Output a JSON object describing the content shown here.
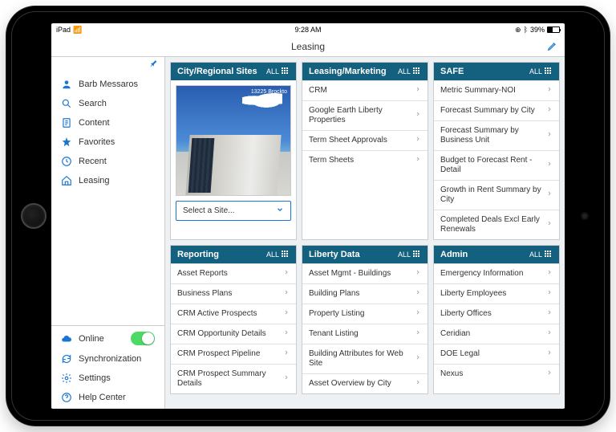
{
  "status": {
    "carrier": "iPad",
    "time": "9:28 AM",
    "batteryPct": "39%"
  },
  "page": {
    "title": "Leasing"
  },
  "sidebar": {
    "top": [
      {
        "label": "Barb Messaros",
        "icon": "user"
      },
      {
        "label": "Search",
        "icon": "search"
      },
      {
        "label": "Content",
        "icon": "content"
      },
      {
        "label": "Favorites",
        "icon": "star"
      },
      {
        "label": "Recent",
        "icon": "clock"
      },
      {
        "label": "Leasing",
        "icon": "home"
      }
    ],
    "bottom": [
      {
        "label": "Online",
        "icon": "cloud",
        "toggle": true
      },
      {
        "label": "Synchronization",
        "icon": "sync"
      },
      {
        "label": "Settings",
        "icon": "gear"
      },
      {
        "label": "Help Center",
        "icon": "help"
      }
    ]
  },
  "tiles": [
    {
      "title": "City/Regional Sites",
      "all": "ALL",
      "type": "image",
      "imageLabel": "13225 Brockto",
      "selectPlaceholder": "Select a Site..."
    },
    {
      "title": "Leasing/Marketing",
      "all": "ALL",
      "items": [
        "CRM",
        "Google Earth Liberty Properties",
        "Term Sheet Approvals",
        "Term Sheets"
      ]
    },
    {
      "title": "SAFE",
      "all": "ALL",
      "items": [
        "Metric Summary-NOI",
        "Forecast Summary by City",
        "Forecast Summary by Business Unit",
        "Budget to Forecast Rent - Detail",
        "Growth in Rent Summary by City",
        "Completed Deals Excl Early Renewals"
      ]
    },
    {
      "title": "Reporting",
      "all": "ALL",
      "items": [
        "Asset Reports",
        "Business Plans",
        "CRM Active Prospects",
        "CRM Opportunity Details",
        "CRM Prospect Pipeline",
        "CRM Prospect Summary Details"
      ]
    },
    {
      "title": "Liberty Data",
      "all": "ALL",
      "items": [
        "Asset Mgmt - Buildings",
        "Building Plans",
        "Property Listing",
        "Tenant Listing",
        "Building Attributes for Web Site",
        "Asset Overview by City"
      ]
    },
    {
      "title": "Admin",
      "all": "ALL",
      "items": [
        "Emergency Information",
        "Liberty Employees",
        "Liberty Offices",
        "Ceridian",
        "DOE Legal",
        "Nexus"
      ]
    }
  ]
}
